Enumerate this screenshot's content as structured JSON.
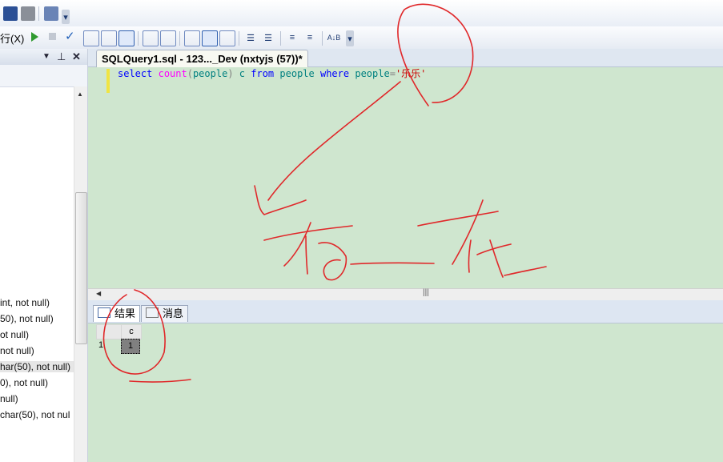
{
  "toolbar": {
    "execute_label": "行(X)",
    "icons": [
      "save-icon",
      "print-icon",
      "report-icon",
      "dropdown-icon"
    ]
  },
  "explorer": {
    "lines": [
      "int, not null)",
      "50), not null)",
      "ot null)",
      "not null)",
      "har(50), not null)",
      "0), not null)",
      "null)",
      "char(50), not nul"
    ]
  },
  "editor_tab": {
    "title": "SQLQuery1.sql - 123..._Dev (nxtyjs (57))*"
  },
  "editor": {
    "line1": {
      "kw1": "select",
      "fn": "count",
      "paren_open": "(",
      "arg": "people",
      "paren_close": ")",
      "alias": "c",
      "kw2": "from",
      "table": "people",
      "kw3": "where",
      "col": "people",
      "op": "=",
      "literal": "'乐乐'"
    }
  },
  "results": {
    "tabs": [
      {
        "label": "结果",
        "active": true
      },
      {
        "label": "消息",
        "active": false
      }
    ],
    "column_header": "c",
    "row_number": "1",
    "cell_value": "1"
  },
  "colors": {
    "editor_bg": "#cfe6cf",
    "keyword": "#0000ff",
    "function": "#ff00ff",
    "string": "#cc0000",
    "ink": "#e0282a"
  }
}
